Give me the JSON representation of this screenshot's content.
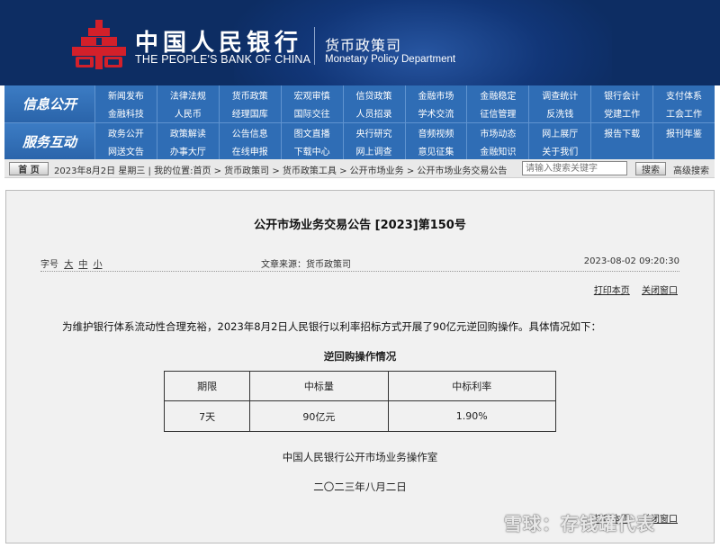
{
  "header": {
    "bank_name_cn": "中国人民银行",
    "bank_name_en": "THE PEOPLE'S BANK OF CHINA",
    "dept_cn": "货币政策司",
    "dept_en": "Monetary Policy Department",
    "logo_color": "#d3202a",
    "banner_color": "#0d2d63"
  },
  "nav": {
    "row1_title": "信息公开",
    "row1_items": [
      "新闻发布",
      "法律法规",
      "货币政策",
      "宏观审慎",
      "信贷政策",
      "金融市场",
      "金融稳定",
      "调查统计",
      "银行会计",
      "支付体系",
      "金融科技",
      "人民币",
      "经理国库",
      "国际交往",
      "人员招录",
      "学术交流",
      "征信管理",
      "反洗钱",
      "党建工作",
      "工会工作"
    ],
    "row2_title": "服务互动",
    "row2_items": [
      "政务公开",
      "政策解读",
      "公告信息",
      "图文直播",
      "央行研究",
      "音频视频",
      "市场动态",
      "网上展厅",
      "报告下载",
      "报刊年鉴",
      "网送文告",
      "办事大厅",
      "在线申报",
      "下载中心",
      "网上调查",
      "意见征集",
      "金融知识",
      "关于我们",
      "",
      ""
    ]
  },
  "breadcrumb": {
    "home_label": "首 页",
    "text": "2023年8月2日 星期三 | 我的位置:首页 > 货币政策司 > 货币政策工具 > 公开市场业务 > 公开市场业务交易公告",
    "search_placeholder": "请输入搜索关键字",
    "search_button": "搜索",
    "advanced_search": "高级搜索"
  },
  "article": {
    "title": "公开市场业务交易公告 [2023]第150号",
    "font_size_label": "字号",
    "font_size_options": [
      "大",
      "中",
      "小"
    ],
    "source": "文章来源：货币政策司",
    "datetime": "2023-08-02 09:20:30",
    "print_link": "打印本页",
    "close_link": "关闭窗口",
    "paragraph": "为维护银行体系流动性合理充裕，2023年8月2日人民银行以利率招标方式开展了90亿元逆回购操作。具体情况如下：",
    "table_title": "逆回购操作情况",
    "table": {
      "headers": [
        "期限",
        "中标量",
        "中标利率"
      ],
      "rows": [
        [
          "7天",
          "90亿元",
          "1.90%"
        ]
      ]
    },
    "signature": "中国人民银行公开市场业务操作室",
    "sign_date": "二〇二三年八月二日",
    "print_link_bottom": "打印本页",
    "close_link_bottom": "关闭窗口"
  },
  "watermark": "雪球：存钱罐代表"
}
